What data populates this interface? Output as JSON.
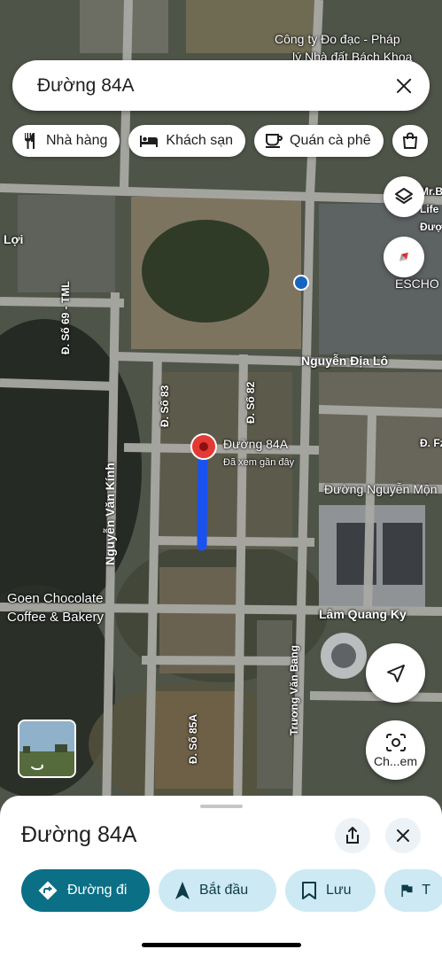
{
  "search": {
    "query": "Đường 84A"
  },
  "chips": [
    {
      "label": "Nhà hàng",
      "icon": "restaurant-icon"
    },
    {
      "label": "Khách sạn",
      "icon": "hotel-icon"
    },
    {
      "label": "Quán cà phê",
      "icon": "cafe-icon"
    },
    {
      "label": "",
      "icon": "shopping-icon"
    }
  ],
  "map_labels": {
    "company": "Công ty Đo đạc - Pháp",
    "company2": "lý Nhà đất Bách Khoa",
    "mrb": "Mr.B",
    "life": "Life",
    "duoc": "Được",
    "escho": "ESCHO",
    "loi": "Lợi",
    "so69": "Đ. Số 69 - TML",
    "nguyen_dia_lo": "Nguyễn Địa Lô",
    "so83": "Đ. Số 83",
    "so82": "Đ. Số 82",
    "duong84a": "Đường 84A",
    "viewed": "Đã xem gần đây",
    "dfz": "Đ. Fz",
    "nguyen_mon": "Đường Nguyễn Mộn",
    "nguyen_van_kinh": "Nguyễn Văn Kính",
    "goen1": "Goen Chocolate",
    "goen2": "Coffee & Bakery",
    "lam_quang_ky": "Lâm Quang Ky",
    "truong_van_bang": "Trương Văn Bang",
    "so85a": "Đ. Số 85A",
    "chem": "Ch...em"
  },
  "sheet": {
    "title": "Đường 84A",
    "actions": [
      {
        "label": "Đường đi",
        "icon": "directions-icon"
      },
      {
        "label": "Bắt đầu",
        "icon": "navigation-arrow-icon"
      },
      {
        "label": "Lưu",
        "icon": "bookmark-icon"
      },
      {
        "label": "T",
        "icon": "flag-icon"
      }
    ]
  },
  "colors": {
    "route": "#1a52f0",
    "pin": "#e53935",
    "primary_action": "#0b6f86",
    "secondary_action": "#cde9f3"
  }
}
